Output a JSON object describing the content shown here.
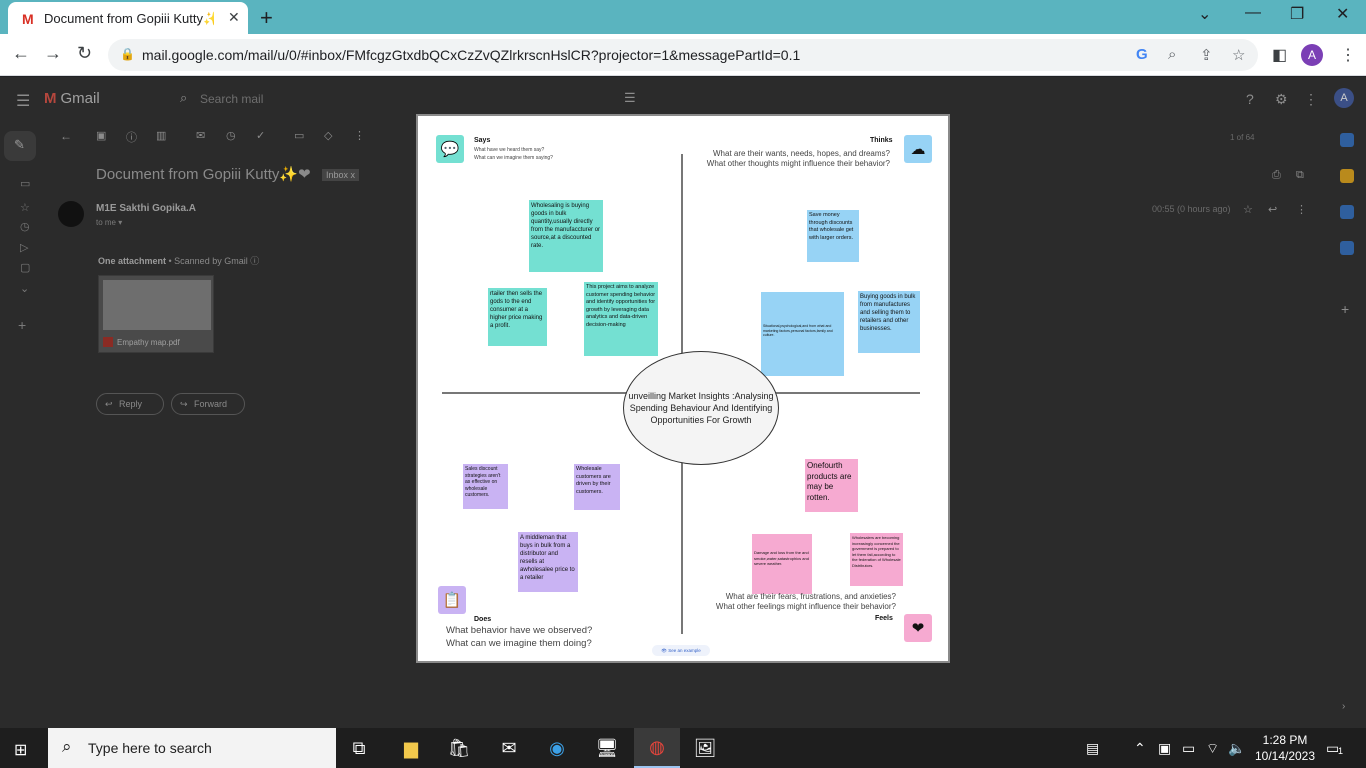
{
  "browser": {
    "tab_title": "Document from Gopiii Kutty✨❤",
    "favicon": "M",
    "url": "mail.google.com/mail/u/0/#inbox/FMfcgzGtxdbQCxCzZvQZlrkrscnHslCR?projector=1&messagePartId=0.1",
    "profile_initial": "A",
    "icons": [
      "back-icon",
      "forward-icon",
      "reload-icon",
      "lock-icon",
      "google-icon",
      "zoom-icon",
      "share-icon",
      "star-icon",
      "side-panel-icon",
      "menu-dots-icon"
    ]
  },
  "gmail": {
    "logo_text": "Gmail",
    "search_placeholder": "Search mail",
    "subject": "Document from Gopiii Kutty✨❤",
    "inbox_chip": "Inbox x",
    "sender": "M1E Sakthi Gopika.A",
    "to": "to me ▾",
    "time": "00:55 (0 hours ago)",
    "pager": "1 of 64",
    "attachment_header": "One attachment",
    "attachment_scan": " • Scanned by Gmail ⓘ",
    "attachment_name": "Empathy map.pdf",
    "reply_label": "Reply",
    "forward_label": "Forward",
    "avatar_initial": "A"
  },
  "document": {
    "center_title": "unveilling Market Insights :Analysing Spending Behaviour And Identifying Opportunities For Growth",
    "says": {
      "title": "Says",
      "sub1": "What have we heard them say?",
      "sub2": "What can we imagine them saying?",
      "notes": [
        "Wholesaling is buying goods in bulk quantity,usually directly from the manufaccturer or source,at a discounted rate.",
        "rtailer then sells the gods to the end consumer at a higher price making a profit.",
        "This project aims to analyze customer spending behavior and identify opportunities for growth by leveraging data analytics and data-driven decision-making"
      ]
    },
    "thinks": {
      "title": "Thinks",
      "sub1": "What are their wants, needs, hopes, and dreams?",
      "sub2": "What other thoughts might influence their behavior?",
      "notes": [
        "Save money through discounts that wholesale get with larger orders.",
        "Situational,psychological,and from what and marketing factors,personal factors,family and culture.",
        "Buying goods in bulk from manufactures and selling them to retailers and other businesses."
      ]
    },
    "does": {
      "title": "Does",
      "sub1": "What behavior have we observed?",
      "sub2": "What can we imagine them doing?",
      "notes": [
        "Sales discount strategies aren't as effective on wholesale customers.",
        "Wholesale customers are driven by their customers.",
        "A middleman that buys in bulk from a distributor and resells at awholesalee price to a retailer"
      ]
    },
    "feels": {
      "title": "Feels",
      "sub1": "What are their fears, frustrations, and anxieties?",
      "sub2": "What other feelings might influence their behavior?",
      "notes": [
        "Onefourth products are may be rotten.",
        "Damage and loss from the and smoke,water,satastrophics and severe weather.",
        "Wholesalers are becoming increasingly concerned the government is prepared to let them fail,according to the federation of Wholesale Distributors."
      ]
    },
    "example_button": "See an example"
  },
  "taskbar": {
    "search_placeholder": "Type here to search",
    "time": "1:28 PM",
    "date": "10/14/2023",
    "notification_count": "1"
  },
  "colors": {
    "tab_strip": "#5ab4bf",
    "teal_note": "#74e0d2",
    "blue_note": "#97d3f5",
    "purple_note": "#c9b3f3",
    "pink_note": "#f6aad1"
  }
}
